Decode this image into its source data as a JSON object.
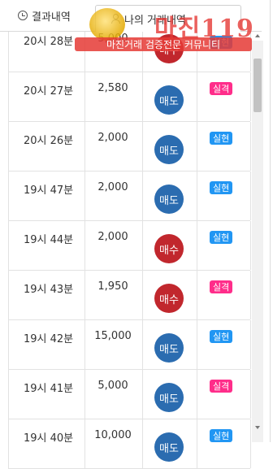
{
  "tabs": [
    {
      "label": "결과내역"
    },
    {
      "label": "나의 거래내역"
    }
  ],
  "rows": [
    {
      "time": "20시 28분",
      "amount": "5,000",
      "action": "매수",
      "result": "실현"
    },
    {
      "time": "20시 27분",
      "amount": "2,580",
      "action": "매도",
      "result": "실격"
    },
    {
      "time": "20시 26분",
      "amount": "2,000",
      "action": "매도",
      "result": "실현"
    },
    {
      "time": "19시 47분",
      "amount": "2,000",
      "action": "매도",
      "result": "실현"
    },
    {
      "time": "19시 44분",
      "amount": "2,000",
      "action": "매수",
      "result": "실현"
    },
    {
      "time": "19시 43분",
      "amount": "1,950",
      "action": "매수",
      "result": "실격"
    },
    {
      "time": "19시 42분",
      "amount": "15,000",
      "action": "매도",
      "result": "실현"
    },
    {
      "time": "19시 41분",
      "amount": "5,000",
      "action": "매도",
      "result": "실격"
    },
    {
      "time": "19시 40분",
      "amount": "10,000",
      "action": "매도",
      "result": "실현"
    }
  ],
  "watermark": {
    "brand": "마진119",
    "caption": "마진거래 검증전문 커뮤니티"
  },
  "colors": {
    "buy": "#c1272d",
    "sell": "#2b6cb0",
    "hit": "#2196f3",
    "miss": "#ff2d8a"
  }
}
